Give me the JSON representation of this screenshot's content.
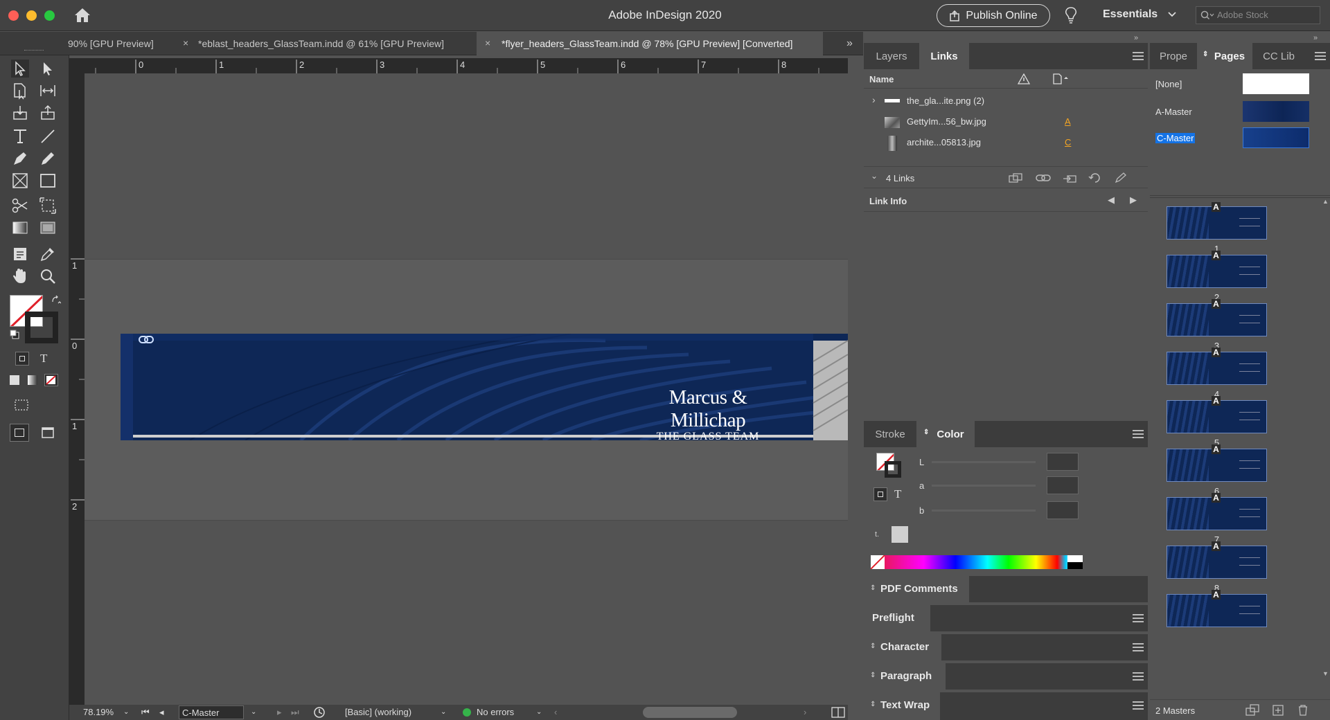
{
  "app": {
    "title": "Adobe InDesign 2020",
    "publish_label": "Publish Online",
    "workspace": "Essentials",
    "stock_placeholder": "Adobe Stock"
  },
  "doc_tabs": [
    {
      "label": "90% [GPU Preview]",
      "active": false
    },
    {
      "label": "*eblast_headers_GlassTeam.indd @ 61% [GPU Preview]",
      "active": false
    },
    {
      "label": "*flyer_headers_GlassTeam.indd @ 78% [GPU Preview] [Converted]",
      "active": true
    }
  ],
  "rulers": {
    "horizontal": [
      "0",
      "1",
      "2",
      "3",
      "4",
      "5",
      "6",
      "7",
      "8"
    ],
    "vertical": [
      "1",
      "0",
      "1",
      "2"
    ]
  },
  "banner": {
    "brand_line1": "Marcus & Millichap",
    "brand_line2": "THE GLASS TEAM",
    "bg_color": "#0e2756"
  },
  "status": {
    "zoom": "78.19%",
    "page": "C-Master",
    "preflight_profile": "[Basic] (working)",
    "errors": "No errors"
  },
  "links_panel": {
    "tabs": [
      "Layers",
      "Links"
    ],
    "active_tab": "Links",
    "column_name": "Name",
    "items": [
      {
        "name": "the_gla...ite.png (2)",
        "page": ""
      },
      {
        "name": "GettyIm...56_bw.jpg",
        "page": "A"
      },
      {
        "name": "archite...05813.jpg",
        "page": "C"
      }
    ],
    "count_label": "4 Links",
    "link_info_label": "Link Info"
  },
  "color_panel": {
    "tabs": [
      "Stroke",
      "Color"
    ],
    "active_tab": "Color",
    "channels": [
      "L",
      "a",
      "b"
    ],
    "text_toggle": "T"
  },
  "collapsed_panels": [
    {
      "label": "PDF Comments",
      "arrows": true
    },
    {
      "label": "Preflight",
      "arrows": false
    },
    {
      "label": "Character",
      "arrows": true
    },
    {
      "label": "Paragraph",
      "arrows": true
    },
    {
      "label": "Text Wrap",
      "arrows": true
    }
  ],
  "pages_panel": {
    "tabs": [
      "Prope",
      "Pages",
      "CC Lib"
    ],
    "active_tab": "Pages",
    "masters": [
      {
        "name": "[None]"
      },
      {
        "name": "A-Master"
      },
      {
        "name": "C-Master",
        "selected": true
      }
    ],
    "pages": [
      {
        "number": "1",
        "master": "A"
      },
      {
        "number": "2",
        "master": "A"
      },
      {
        "number": "3",
        "master": "A"
      },
      {
        "number": "4",
        "master": "A"
      },
      {
        "number": "5",
        "master": "A"
      },
      {
        "number": "6",
        "master": "A"
      },
      {
        "number": "7",
        "master": "A"
      },
      {
        "number": "8",
        "master": "A"
      },
      {
        "number": "",
        "master": "A"
      }
    ],
    "footer_label": "2 Masters"
  }
}
